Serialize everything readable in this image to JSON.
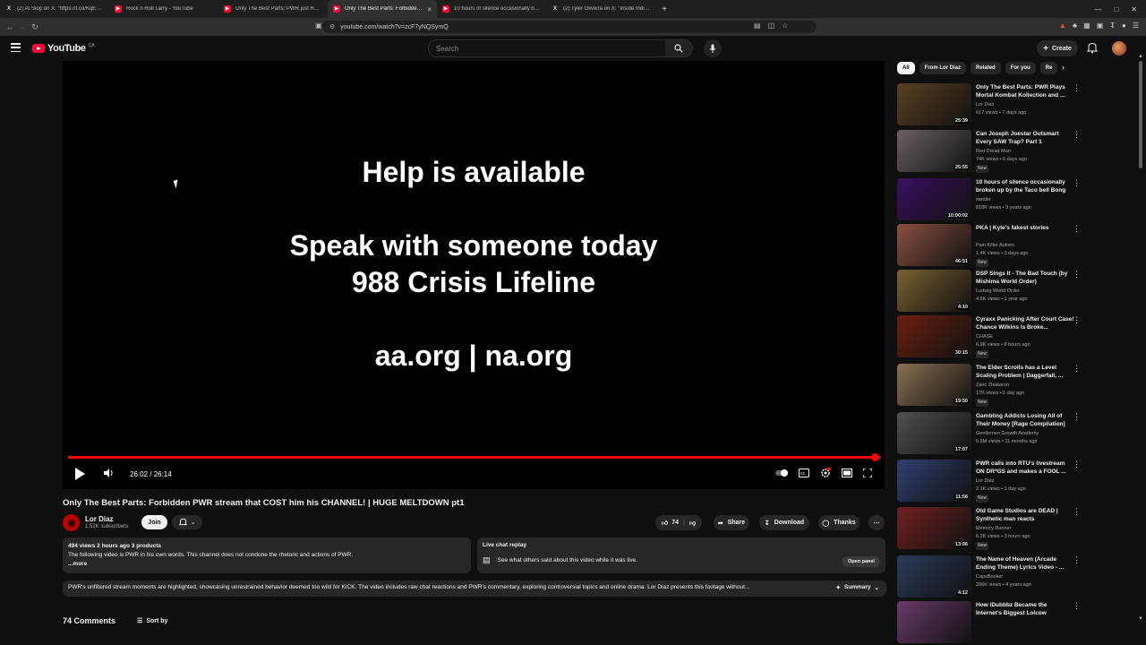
{
  "tabs": [
    {
      "icon": "x",
      "title": "(2) AI Slop on X: \"https://t.co/KqEX1..."
    },
    {
      "icon": "yt",
      "title": "Rock n Roll Larry - YouTube"
    },
    {
      "icon": "yt",
      "title": "Only The Best Parts: PWR just RUINE..."
    },
    {
      "icon": "yt",
      "title": "Only The Best Parts: Forbidden P...",
      "active": true
    },
    {
      "icon": "yt",
      "title": "10 hours of silence occasionally brok..."
    },
    {
      "icon": "x",
      "title": "(2) Tyler Oliveira on X: \"Inside India's..."
    }
  ],
  "browser": {
    "url": "youtube.com/watch?v=zcF7yNQSymQ"
  },
  "header": {
    "search_placeholder": "Search",
    "create_label": "Create",
    "region": "CA",
    "wordmark": "YouTube"
  },
  "player": {
    "lines": [
      "Help is available",
      "Speak with someone today",
      "988 Crisis Lifeline",
      "aa.org | na.org"
    ],
    "time": "26:02 / 26:14",
    "progress": 0.992
  },
  "video": {
    "title": "Only The Best Parts: Forbidden PWR stream that COST him his CHANNEL! | HUGE MELTDOWN pt1",
    "channel": "Lor Diaz",
    "subs": "1.52K subscribers",
    "join": "Join",
    "likes": "74",
    "share": "Share",
    "download": "Download",
    "thanks": "Thanks"
  },
  "description": {
    "meta": "494 views  2 hours ago  3 products",
    "text": "The following video is PWR in his own words. This channel does not condone the rhetoric and actions of PWR.",
    "more": "...more"
  },
  "chat": {
    "title": "Live chat replay",
    "text": "See what others said about this video while it was live.",
    "open": "Open panel"
  },
  "summary": {
    "text": "PWR's unfiltered stream moments are highlighted, showcasing unrestrained behavior deemed too wild for KICK. The video includes raw chat reactions and PWR's commentary, exploring controversial topics and online drama. Lor Diaz presents this footage without...",
    "button": "Summary"
  },
  "comments": {
    "count": "74 Comments",
    "sort": "Sort by"
  },
  "chips": [
    "All",
    "From Lor Diaz",
    "Related",
    "For you",
    "Re"
  ],
  "recs": [
    {
      "title": "Only The Best Parts: PWR Plays Mortal Kombat Kollection and ...",
      "channel": "Lor Diaz",
      "stats": "617 views • 7 days ago",
      "dur": "25:39",
      "color": "#5a4020",
      "new": false
    },
    {
      "title": "Can Joseph Joestar Outsmart Every SAW Trap? Part 1",
      "channel": "Red Dread Man",
      "stats": "74K views • 6 days ago",
      "dur": "25:55",
      "color": "#6a6060",
      "new": true
    },
    {
      "title": "10 hours of silence occasionally broken up by the Taco bell Bong",
      "channel": "xander",
      "stats": "818K views • 3 years ago",
      "dur": "10:00:02",
      "color": "#3a1060",
      "new": false
    },
    {
      "title": "PKA | Kyle's fakest stories",
      "channel": "Pain Killer Autism",
      "stats": "1.4K views • 3 days ago",
      "dur": "46:51",
      "color": "#8a5040",
      "new": true
    },
    {
      "title": "DSP Sings It - The Bad Touch (by Mishima World Order)",
      "channel": "Ludwig World Order",
      "stats": "4.5K views • 1 year ago",
      "dur": "4:10",
      "color": "#7a6030",
      "new": false
    },
    {
      "title": "Cyraxx Panicking After Court Case! Chance Wilkins Is Broke...",
      "channel": "CHASE",
      "stats": "6.9K views • 8 hours ago",
      "dur": "30:15",
      "color": "#6a2010",
      "new": true
    },
    {
      "title": "The Elder Scrolls has a Level Scaling Problem | Daggerfall, ...",
      "channel": "Zaric Zhakaron",
      "stats": "17K views • 1 day ago",
      "dur": "19:50",
      "color": "#8a7050",
      "new": true
    },
    {
      "title": "Gambling Addicts Losing All of Their Money [Rage Compilation]",
      "channel": "Gentlemen Growth Academy",
      "stats": "5.5M views • 11 months ago",
      "dur": "17:07",
      "color": "#505050",
      "new": false
    },
    {
      "title": "PWR calls into RTU's livestream ON DR*GS and makes a FOOL ...",
      "channel": "Lor Diaz",
      "stats": "2.1K views • 1 day ago",
      "dur": "11:56",
      "color": "#304070",
      "new": true
    },
    {
      "title": "Old Game Studios are DEAD | Synthetic man reacts",
      "channel": "Memory Runner",
      "stats": "6.2K views • 3 hours ago",
      "dur": "13:06",
      "color": "#702020",
      "new": true
    },
    {
      "title": "The Name of Heaven (Arcade Ending Theme) Lyrics Video - ...",
      "channel": "CapsBooker",
      "stats": "206K views • 4 years ago",
      "dur": "4:12",
      "color": "#2a3a5a",
      "new": false
    },
    {
      "title": "How iDubbbz Became the Internet's Biggest Lolcow",
      "channel": "",
      "stats": "",
      "dur": "",
      "color": "#6a3a6a",
      "new": false
    }
  ]
}
